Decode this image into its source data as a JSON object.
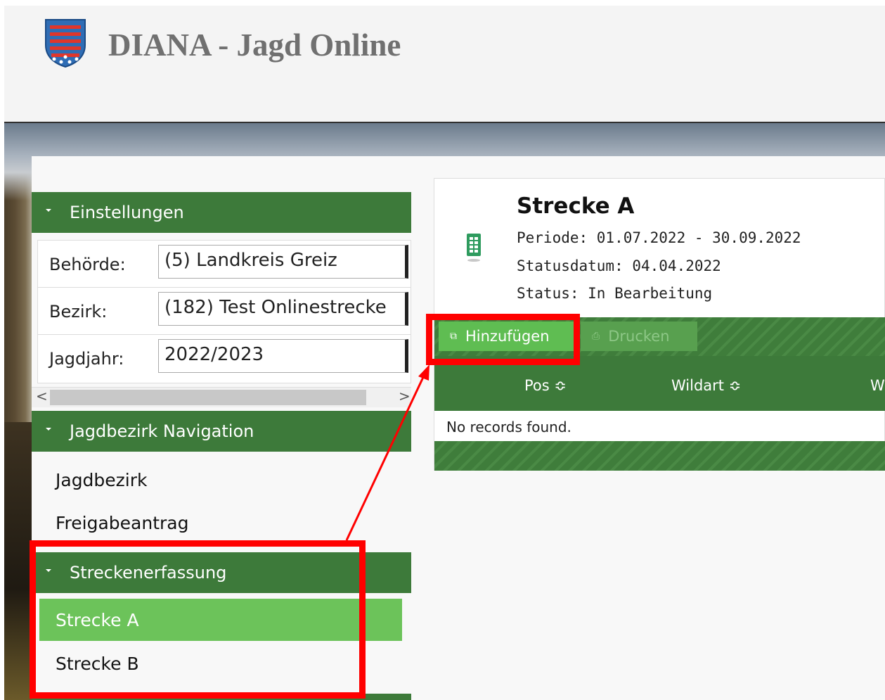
{
  "header": {
    "title": "DIANA - Jagd Online",
    "logo_icon": "thuringia-coat-of-arms-icon"
  },
  "sidebar": {
    "settings": {
      "title": "Einstellungen",
      "fields": [
        {
          "label": "Behörde:",
          "value": "(5) Landkreis Greiz"
        },
        {
          "label": "Bezirk:",
          "value": "(182) Test Onlinestrecke"
        },
        {
          "label": "Jagdjahr:",
          "value": "2022/2023"
        }
      ]
    },
    "navigation": {
      "title": "Jagdbezirk Navigation",
      "items": [
        "Jagdbezirk",
        "Freigabeantrag"
      ]
    },
    "capture": {
      "title": "Streckenerfassung",
      "items": [
        "Strecke A",
        "Strecke B"
      ],
      "active_index": 0
    },
    "scroll_arrows": {
      "left": "<",
      "right": ">"
    }
  },
  "content": {
    "title": "Strecke A",
    "periode": "Periode: 01.07.2022 - 30.09.2022",
    "statusdatum": "Statusdatum: 04.04.2022",
    "status": "Status: In Bearbeitung",
    "toolbar": {
      "add_label": "Hinzufügen",
      "print_label": "Drucken"
    },
    "table": {
      "columns": [
        "Pos ≎",
        "Wildart ≎",
        "W"
      ],
      "empty_message": "No records found."
    }
  },
  "colors": {
    "accent_green": "#3d7a3a",
    "active_green": "#6cc35a",
    "annotation_red": "#ff0000"
  }
}
